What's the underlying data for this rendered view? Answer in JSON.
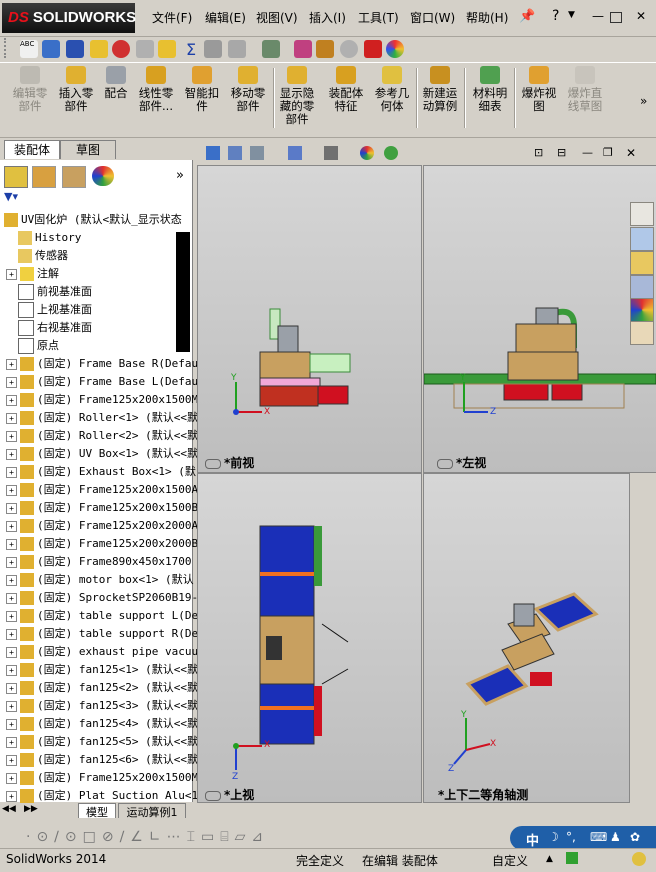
{
  "app": {
    "logo": "SOLIDWORKS",
    "logo_prefix": "DS",
    "menu": [
      "文件(F)",
      "编辑(E)",
      "视图(V)",
      "插入(I)",
      "工具(T)",
      "窗口(W)",
      "帮助(H)"
    ],
    "help_label": "?"
  },
  "command_manager": {
    "buttons": [
      {
        "label": "编辑零\n部件",
        "icon": "edit-component-icon",
        "disabled": true
      },
      {
        "label": "插入零\n部件",
        "icon": "insert-component-icon",
        "disabled": false
      },
      {
        "label": "配合",
        "icon": "mate-icon",
        "disabled": false
      },
      {
        "label": "线性零\n部件...",
        "icon": "linear-pattern-icon",
        "disabled": false
      },
      {
        "label": "智能扣\n件",
        "icon": "smart-fastener-icon",
        "disabled": false
      },
      {
        "label": "移动零\n部件",
        "icon": "move-component-icon",
        "disabled": false
      },
      {
        "label": "显示隐\n藏的零\n部件",
        "icon": "show-hidden-icon",
        "disabled": false
      },
      {
        "label": "装配体\n特征",
        "icon": "assembly-feature-icon",
        "disabled": false
      },
      {
        "label": "参考几\n何体",
        "icon": "reference-geometry-icon",
        "disabled": false
      },
      {
        "label": "新建运\n动算例",
        "icon": "new-motion-study-icon",
        "disabled": false
      },
      {
        "label": "材料明\n细表",
        "icon": "bom-icon",
        "disabled": false
      },
      {
        "label": "爆炸视\n图",
        "icon": "exploded-view-icon",
        "disabled": false
      },
      {
        "label": "爆炸直\n线草图",
        "icon": "explode-line-icon",
        "disabled": true
      }
    ]
  },
  "tabs_top": [
    "装配体",
    "草图"
  ],
  "tree": {
    "root": "UV固化炉  (默认<默认_显示状态",
    "items": [
      {
        "label": "History",
        "icon": "history-icon",
        "expand": false
      },
      {
        "label": "传感器",
        "icon": "sensor-icon",
        "expand": false
      },
      {
        "label": "注解",
        "icon": "annotation-icon",
        "expand": true
      },
      {
        "label": "前视基准面",
        "icon": "plane-icon",
        "expand": false
      },
      {
        "label": "上视基准面",
        "icon": "plane-icon",
        "expand": false
      },
      {
        "label": "右视基准面",
        "icon": "plane-icon",
        "expand": false
      },
      {
        "label": "原点",
        "icon": "origin-icon",
        "expand": false
      },
      {
        "label": "(固定) Frame Base R(Defau",
        "icon": "part-icon",
        "expand": true
      },
      {
        "label": "(固定) Frame Base L(Defau",
        "icon": "part-icon",
        "expand": true
      },
      {
        "label": "(固定) Frame125x200x1500M",
        "icon": "part-icon",
        "expand": true
      },
      {
        "label": "(固定) Roller<1> (默认<<默",
        "icon": "part-icon",
        "expand": true
      },
      {
        "label": "(固定) Roller<2> (默认<<默",
        "icon": "part-icon",
        "expand": true
      },
      {
        "label": "(固定) UV Box<1> (默认<<默",
        "icon": "part-icon",
        "expand": true
      },
      {
        "label": "(固定) Exhaust Box<1> (默",
        "icon": "part-icon",
        "expand": true
      },
      {
        "label": "(固定) Frame125x200x1500A",
        "icon": "part-icon",
        "expand": true
      },
      {
        "label": "(固定) Frame125x200x1500B",
        "icon": "part-icon",
        "expand": true
      },
      {
        "label": "(固定) Frame125x200x2000A",
        "icon": "part-icon",
        "expand": true
      },
      {
        "label": "(固定) Frame125x200x2000B",
        "icon": "part-icon",
        "expand": true
      },
      {
        "label": "(固定) Frame890x450x1700",
        "icon": "part-icon",
        "expand": true
      },
      {
        "label": "(固定) motor box<1> (默认",
        "icon": "part-icon",
        "expand": true
      },
      {
        "label": "(固定) SprocketSP2060B19-",
        "icon": "part-icon",
        "expand": true
      },
      {
        "label": "(固定) table support L(De",
        "icon": "part-icon",
        "expand": true
      },
      {
        "label": "(固定) table support R(De",
        "icon": "part-icon",
        "expand": true
      },
      {
        "label": "(固定) exhaust pipe vacuu",
        "icon": "part-icon",
        "expand": true
      },
      {
        "label": "(固定) fan125<1> (默认<<默",
        "icon": "part-icon",
        "expand": true
      },
      {
        "label": "(固定) fan125<2> (默认<<默",
        "icon": "part-icon",
        "expand": true
      },
      {
        "label": "(固定) fan125<3> (默认<<默",
        "icon": "part-icon",
        "expand": true
      },
      {
        "label": "(固定) fan125<4> (默认<<默",
        "icon": "part-icon",
        "expand": true
      },
      {
        "label": "(固定) fan125<5> (默认<<默",
        "icon": "part-icon",
        "expand": true
      },
      {
        "label": "(固定) fan125<6> (默认<<默",
        "icon": "part-icon",
        "expand": true
      },
      {
        "label": "(固定) Frame125x200x1500M",
        "icon": "part-icon",
        "expand": true
      },
      {
        "label": "(固定) Plat Suction Alu<1",
        "icon": "part-icon",
        "expand": true
      }
    ]
  },
  "tabs_bottom": [
    "模型",
    "运动算例1"
  ],
  "viewports": [
    {
      "label": "*前视"
    },
    {
      "label": "*左视"
    },
    {
      "label": "*上视"
    },
    {
      "label": "*上下二等角轴测"
    }
  ],
  "axes": {
    "x": "X",
    "y": "Y",
    "z": "Z"
  },
  "status": {
    "app": "SolidWorks 2014",
    "definition": "完全定义",
    "mode": "在编辑 装配体",
    "custom": "自定义",
    "ime_label": "中"
  },
  "colors": {
    "blue_belt": "#1a2fb8",
    "frame_red": "#d01020",
    "box_tan": "#c8a060",
    "accent_green": "#3a9a3a"
  }
}
